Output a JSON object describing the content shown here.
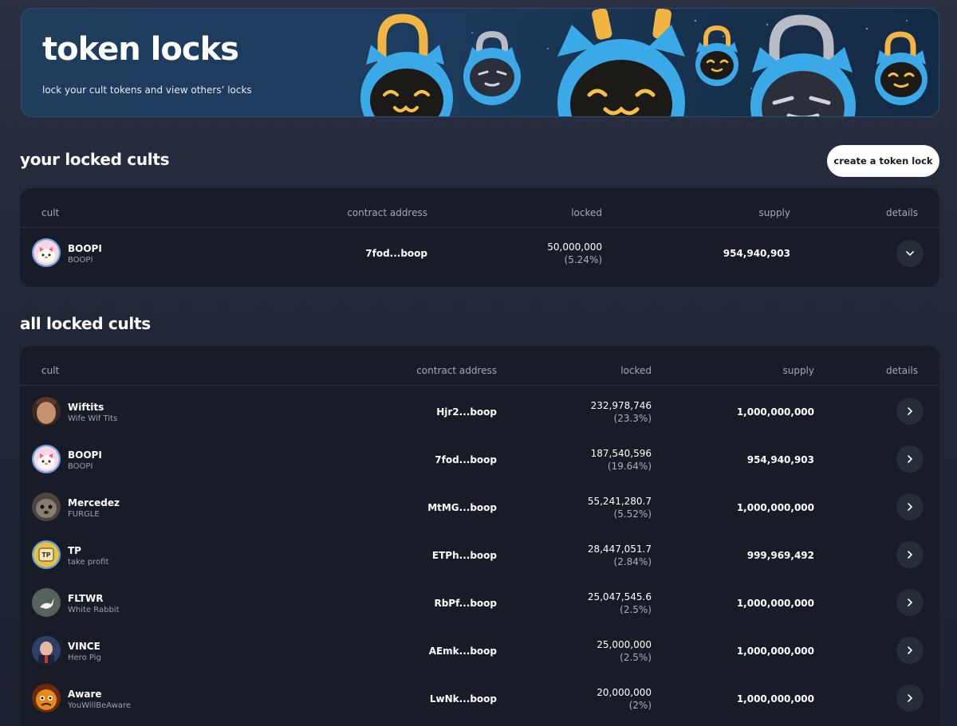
{
  "hero": {
    "title": "token locks",
    "subtitle": "lock your cult tokens and view others’ locks"
  },
  "your_section": {
    "title": "your locked cults",
    "create_button": "create a token lock",
    "columns": [
      "cult",
      "contract address",
      "locked",
      "supply",
      "details"
    ],
    "rows": [
      {
        "name": "BOOPI",
        "ticker": "BOOPI",
        "contract": "7fod...boop",
        "locked": "50,000,000",
        "pct": "(5.24%)",
        "supply": "954,940,903",
        "avatar": "boopi-avatar"
      }
    ]
  },
  "all_section": {
    "title": "all locked cults",
    "columns": [
      "cult",
      "contract address",
      "locked",
      "supply",
      "details"
    ],
    "rows": [
      {
        "name": "Wiftits",
        "ticker": "Wife Wif Tits",
        "contract": "Hjr2...boop",
        "locked": "232,978,746",
        "pct": "(23.3%)",
        "supply": "1,000,000,000",
        "avatar": "wiftits-avatar"
      },
      {
        "name": "BOOPI",
        "ticker": "BOOPI",
        "contract": "7fod...boop",
        "locked": "187,540,596",
        "pct": "(19.64%)",
        "supply": "954,940,903",
        "avatar": "boopi-avatar"
      },
      {
        "name": "Mercedez",
        "ticker": "FURGLE",
        "contract": "MtMG...boop",
        "locked": "55,241,280.7",
        "pct": "(5.52%)",
        "supply": "1,000,000,000",
        "avatar": "mercedez-avatar"
      },
      {
        "name": "TP",
        "ticker": "take profit",
        "contract": "ETPh...boop",
        "locked": "28,447,051.7",
        "pct": "(2.84%)",
        "supply": "999,969,492",
        "avatar": "tp-avatar"
      },
      {
        "name": "FLTWR",
        "ticker": "White Rabbit",
        "contract": "RbPf...boop",
        "locked": "25,047,545.6",
        "pct": "(2.5%)",
        "supply": "1,000,000,000",
        "avatar": "fltwr-avatar"
      },
      {
        "name": "VINCE",
        "ticker": "Hero Pig",
        "contract": "AEmk...boop",
        "locked": "25,000,000",
        "pct": "(2.5%)",
        "supply": "1,000,000,000",
        "avatar": "vince-avatar"
      },
      {
        "name": "Aware",
        "ticker": "YouWillBeAware",
        "contract": "LwNk...boop",
        "locked": "20,000,000",
        "pct": "(2%)",
        "supply": "1,000,000,000",
        "avatar": "aware-avatar"
      }
    ]
  },
  "colors": {
    "accent_blue": "#3ba9e8",
    "lock_gold": "#f2b544",
    "panel": "#171c26"
  }
}
